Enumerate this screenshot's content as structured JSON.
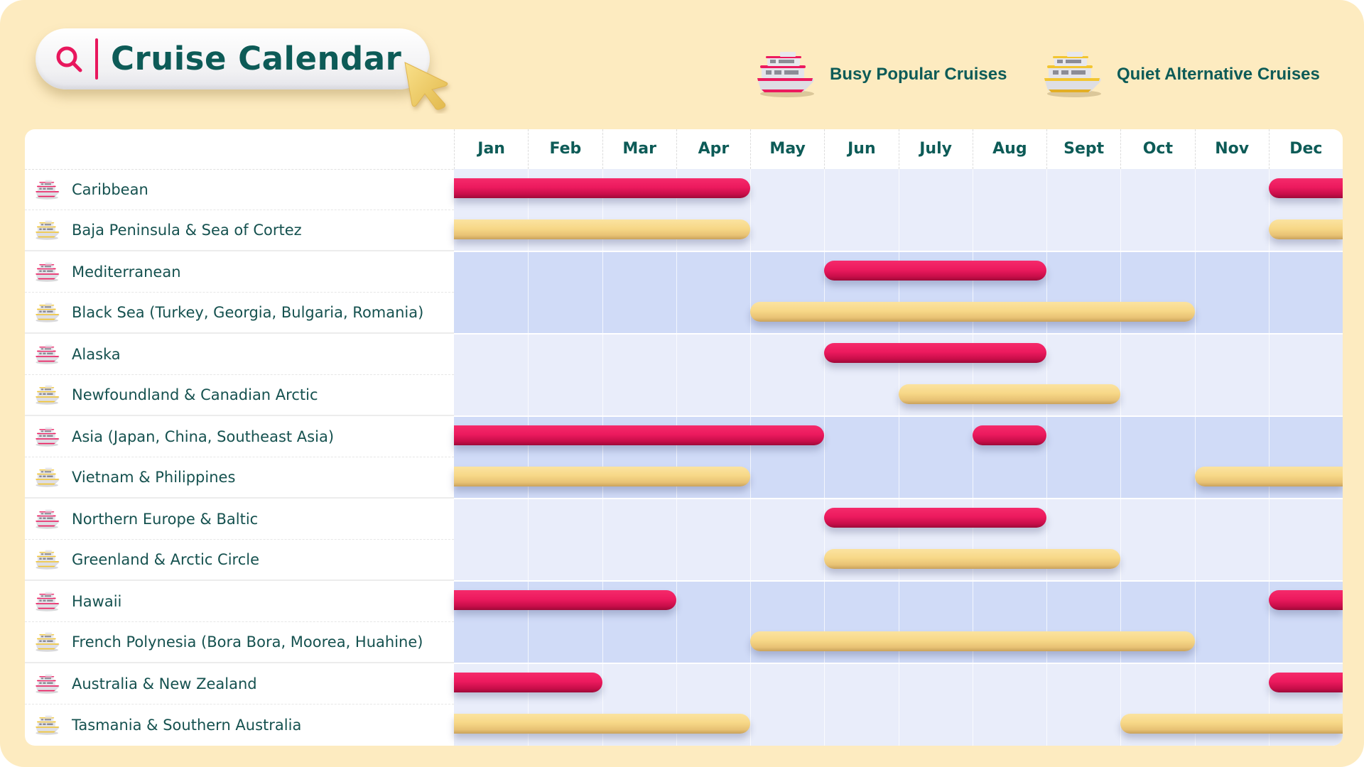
{
  "header": {
    "title": "Cruise Calendar",
    "search_icon": "search-icon",
    "cursor_icon": "pointer-cursor-icon"
  },
  "legend": {
    "busy": {
      "label": "Busy Popular Cruises",
      "icon": "pink-cruise-ship-icon",
      "color": "#EC1A5E"
    },
    "quiet": {
      "label": "Quiet Alternative Cruises",
      "icon": "yellow-cruise-ship-icon",
      "color": "#F7D888"
    }
  },
  "colors": {
    "background": "#FDEBC0",
    "title_text": "#0D5B57",
    "busy": "#EC1A5E",
    "quiet": "#F7D888",
    "band_light": "#E9EDFA",
    "band_dark": "#D0DBF7"
  },
  "chart_data": {
    "type": "gantt",
    "title": "Cruise Calendar",
    "categories": [
      "Jan",
      "Feb",
      "Mar",
      "Apr",
      "May",
      "Jun",
      "July",
      "Aug",
      "Sept",
      "Oct",
      "Nov",
      "Dec"
    ],
    "legend": [
      "Busy Popular Cruises",
      "Quiet Alternative Cruises"
    ],
    "legend_position": "top-right",
    "rows": [
      {
        "label": "Caribbean",
        "type": "busy",
        "group": 0,
        "ranges": [
          [
            1,
            4
          ],
          [
            12,
            12
          ]
        ]
      },
      {
        "label": "Baja Peninsula & Sea of Cortez",
        "type": "quiet",
        "group": 0,
        "ranges": [
          [
            1,
            4
          ],
          [
            12,
            12
          ]
        ]
      },
      {
        "label": "Mediterranean",
        "type": "busy",
        "group": 1,
        "ranges": [
          [
            6,
            8
          ]
        ]
      },
      {
        "label": "Black Sea (Turkey, Georgia, Bulgaria, Romania)",
        "type": "quiet",
        "group": 1,
        "ranges": [
          [
            5,
            10
          ]
        ]
      },
      {
        "label": "Alaska",
        "type": "busy",
        "group": 2,
        "ranges": [
          [
            6,
            8
          ]
        ]
      },
      {
        "label": "Newfoundland & Canadian Arctic",
        "type": "quiet",
        "group": 2,
        "ranges": [
          [
            7,
            9
          ]
        ]
      },
      {
        "label": "Asia (Japan, China, Southeast Asia)",
        "type": "busy",
        "group": 3,
        "ranges": [
          [
            1,
            5
          ],
          [
            8,
            8
          ]
        ]
      },
      {
        "label": "Vietnam & Philippines",
        "type": "quiet",
        "group": 3,
        "ranges": [
          [
            1,
            4
          ],
          [
            11,
            12
          ]
        ]
      },
      {
        "label": "Northern Europe & Baltic",
        "type": "busy",
        "group": 4,
        "ranges": [
          [
            6,
            8
          ]
        ]
      },
      {
        "label": "Greenland & Arctic Circle",
        "type": "quiet",
        "group": 4,
        "ranges": [
          [
            6,
            9
          ]
        ]
      },
      {
        "label": "Hawaii",
        "type": "busy",
        "group": 5,
        "ranges": [
          [
            1,
            3
          ],
          [
            12,
            12
          ]
        ]
      },
      {
        "label": "French Polynesia (Bora Bora, Moorea, Huahine)",
        "type": "quiet",
        "group": 5,
        "ranges": [
          [
            5,
            10
          ]
        ]
      },
      {
        "label": "Australia & New Zealand",
        "type": "busy",
        "group": 6,
        "ranges": [
          [
            1,
            2
          ],
          [
            12,
            12
          ]
        ]
      },
      {
        "label": "Tasmania & Southern Australia",
        "type": "quiet",
        "group": 6,
        "ranges": [
          [
            1,
            4
          ],
          [
            10,
            12
          ]
        ]
      }
    ]
  }
}
